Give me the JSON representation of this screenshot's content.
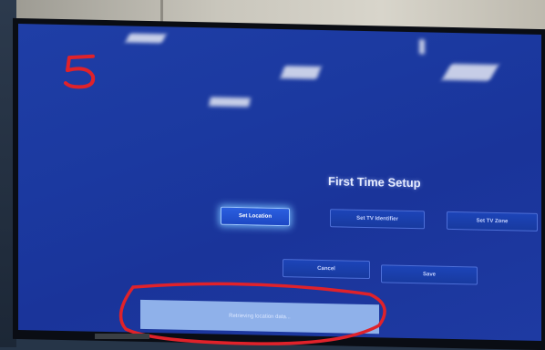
{
  "photo_annotation": {
    "number": "5"
  },
  "tv_screen": {
    "title": "First Time Setup",
    "buttons": [
      {
        "label": "Set Location",
        "focused": true
      },
      {
        "label": "Set TV Identifier",
        "focused": false
      },
      {
        "label": "Set TV Zone",
        "focused": false
      }
    ],
    "actions": [
      {
        "label": "Cancel"
      },
      {
        "label": "Save"
      }
    ],
    "toast_message": "Retrieving location data..."
  },
  "colors": {
    "screen_blue": "#1d3aa2",
    "focus_glow": "#78beff",
    "annotation_red": "#e0222a",
    "toast_bg": "#8fb1ea"
  }
}
